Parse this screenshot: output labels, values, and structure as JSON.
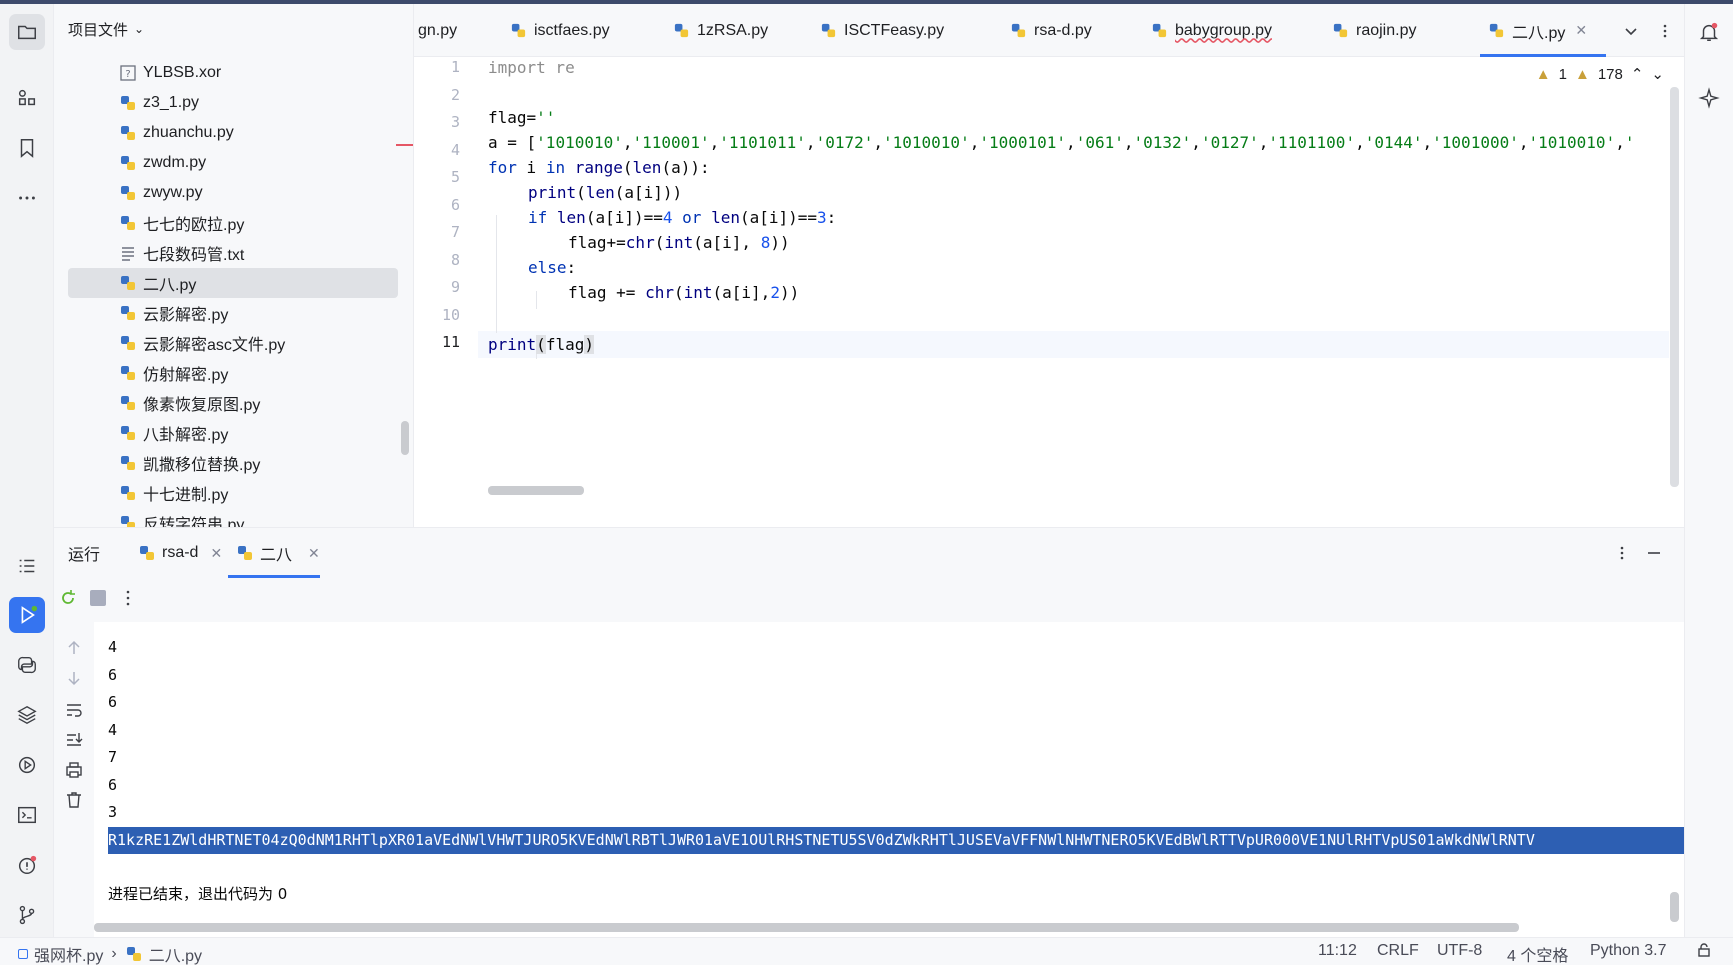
{
  "project_panel": {
    "title": "项目文件",
    "files": [
      {
        "name": "YLBSB.xor",
        "icon": "unknown-file-icon"
      },
      {
        "name": "z3_1.py",
        "icon": "python-file-icon"
      },
      {
        "name": "zhuanchu.py",
        "icon": "python-file-icon"
      },
      {
        "name": "zwdm.py",
        "icon": "python-file-icon"
      },
      {
        "name": "zwyw.py",
        "icon": "python-file-icon"
      },
      {
        "name": "七七的欧拉.py",
        "icon": "python-file-icon"
      },
      {
        "name": "七段数码管.txt",
        "icon": "text-file-icon"
      },
      {
        "name": "二八.py",
        "icon": "python-file-icon",
        "selected": true
      },
      {
        "name": "云影解密.py",
        "icon": "python-file-icon"
      },
      {
        "name": "云影解密asc文件.py",
        "icon": "python-file-icon"
      },
      {
        "name": "仿射解密.py",
        "icon": "python-file-icon"
      },
      {
        "name": "像素恢复原图.py",
        "icon": "python-file-icon"
      },
      {
        "name": "八卦解密.py",
        "icon": "python-file-icon"
      },
      {
        "name": "凯撒移位替换.py",
        "icon": "python-file-icon"
      },
      {
        "name": "十七进制.py",
        "icon": "python-file-icon"
      },
      {
        "name": "反转字符串.py",
        "icon": "python-file-icon"
      }
    ]
  },
  "editor_tabs": [
    {
      "label": "gn.py"
    },
    {
      "label": "isctfaes.py"
    },
    {
      "label": "1zRSA.py"
    },
    {
      "label": "ISCTFeasy.py"
    },
    {
      "label": "rsa-d.py"
    },
    {
      "label": "babygroup.py"
    },
    {
      "label": "raojin.py"
    },
    {
      "label": "二八.py",
      "active": true
    }
  ],
  "inspections": {
    "warnings": "1",
    "weak_warnings": "178"
  },
  "code": {
    "line_numbers": [
      "1",
      "2",
      "3",
      "4",
      "5",
      "6",
      "7",
      "8",
      "9",
      "10",
      "11"
    ],
    "current_line": "11"
  },
  "run_panel": {
    "title": "运行",
    "tabs": [
      {
        "label": "rsa-d"
      },
      {
        "label": "二八",
        "active": true
      }
    ],
    "output_lines": [
      "4",
      "6",
      "6",
      "4",
      "7",
      "6",
      "3"
    ],
    "selected_output": "R1kzRE1ZWldHRTNET04zQ0dNM1RHTlpXR01aVEdNWlVHWTJURO5KVEdNWlRBTlJWR01aVE1OUlRHSTNETU5SV0dZWkRHTlJUSEVaVFFNWlNHWTNERO5KVEdBWlRTTVpUR000VE1NUlRHTVpUS01aWkdNWlRNTV",
    "exit_message": "进程已结束，退出代码为 0"
  },
  "status_bar": {
    "breadcrumb_project": "强网杯.py",
    "breadcrumb_file": "二八.py",
    "position": "11:12",
    "line_ending": "CRLF",
    "encoding": "UTF-8",
    "indent": "4 个空格",
    "interpreter": "Python 3.7"
  }
}
